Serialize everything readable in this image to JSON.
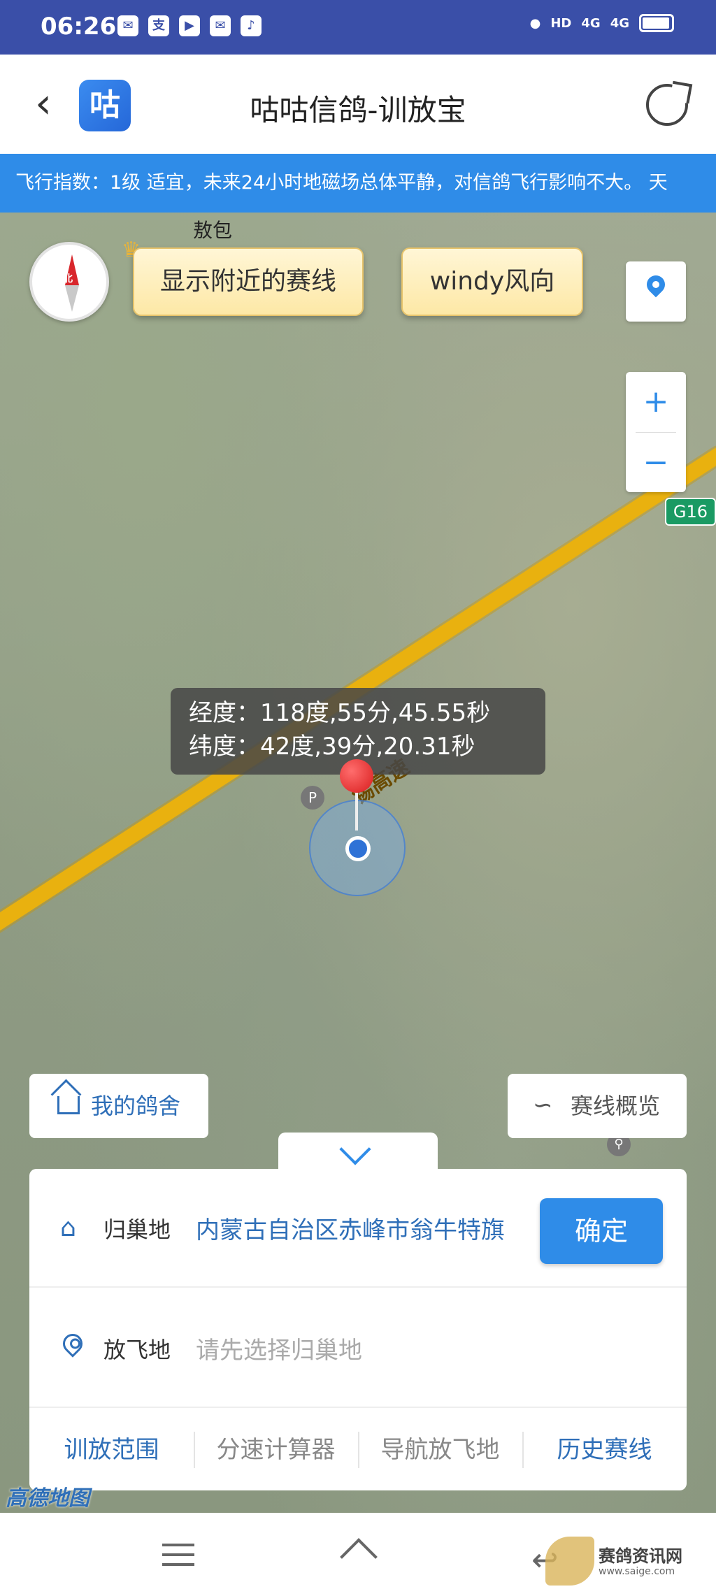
{
  "status_bar": {
    "time": "06:26",
    "network": "HD",
    "signal1": "4G",
    "signal2": "4G"
  },
  "header": {
    "back_icon": "chevron-left-icon",
    "app_logo_text": "咕",
    "title": "咕咕信鸽-训放宝",
    "share_icon": "share-icon"
  },
  "banner": {
    "text": "飞行指数：1级  适宜，未来24小时地磁场总体平静，对信鸽飞行影响不大。 天"
  },
  "map": {
    "place_label": "敖包",
    "road_label": "锡高速",
    "highway_badge": "G16",
    "compass_north": "北",
    "nearby_routes_label": "显示附近的赛线",
    "windy_label": "windy风向",
    "zoom_in": "+",
    "zoom_out": "−",
    "coords": {
      "longitude": "经度：118度,55分,45.55秒",
      "latitude": "纬度：42度,39分,20.31秒"
    },
    "parking_badge": "P",
    "provider_logo": "高德地图"
  },
  "floating": {
    "my_loft_label": "我的鸽舍",
    "route_overview_label": "赛线概览"
  },
  "panel": {
    "home_label": "归巢地",
    "home_value": "内蒙古自治区赤峰市翁牛特旗",
    "confirm_label": "确定",
    "release_label": "放飞地",
    "release_placeholder": "请先选择归巢地",
    "tabs": [
      {
        "label": "训放范围",
        "active": true
      },
      {
        "label": "分速计算器",
        "active": false
      },
      {
        "label": "导航放飞地",
        "active": false
      },
      {
        "label": "历史赛线",
        "active": true
      }
    ]
  },
  "watermark": {
    "name": "赛鸽资讯网",
    "url": "www.saige.com"
  },
  "colors": {
    "accent": "#2f8ce8",
    "status_bar": "#3a4fa8",
    "road": "#e9b10f",
    "pin": "#d81c1c"
  }
}
